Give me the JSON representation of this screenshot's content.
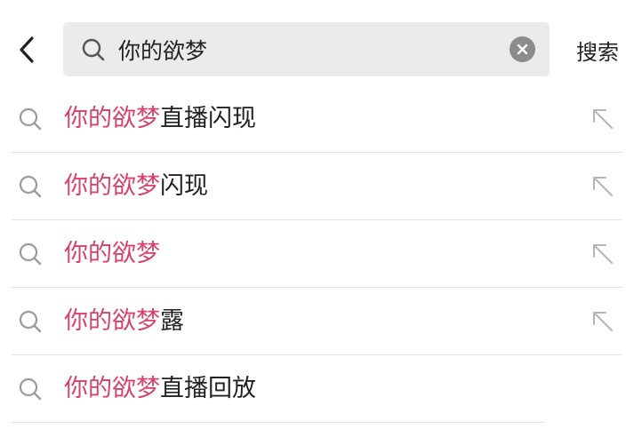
{
  "header": {
    "back_icon": "chevron-left-icon",
    "search": {
      "value": "你的欲梦",
      "placeholder": "",
      "icon": "search-icon",
      "clear_icon": "clear-icon"
    },
    "search_button_label": "搜索"
  },
  "suggestions": [
    {
      "highlight": "你的欲梦",
      "rest": "直播闪现",
      "fill_icon": "arrow-up-left-icon"
    },
    {
      "highlight": "你的欲梦",
      "rest": "闪现",
      "fill_icon": "arrow-up-left-icon"
    },
    {
      "highlight": "你的欲梦",
      "rest": "",
      "fill_icon": "arrow-up-left-icon"
    },
    {
      "highlight": "你的欲梦",
      "rest": "露",
      "fill_icon": "arrow-up-left-icon"
    },
    {
      "highlight": "你的欲梦",
      "rest": "直播回放",
      "fill_icon": ""
    }
  ],
  "colors": {
    "highlight": "#d9406a",
    "text": "#222222",
    "search_bg": "#ebebeb",
    "icon_gray": "#9a9a9a"
  }
}
